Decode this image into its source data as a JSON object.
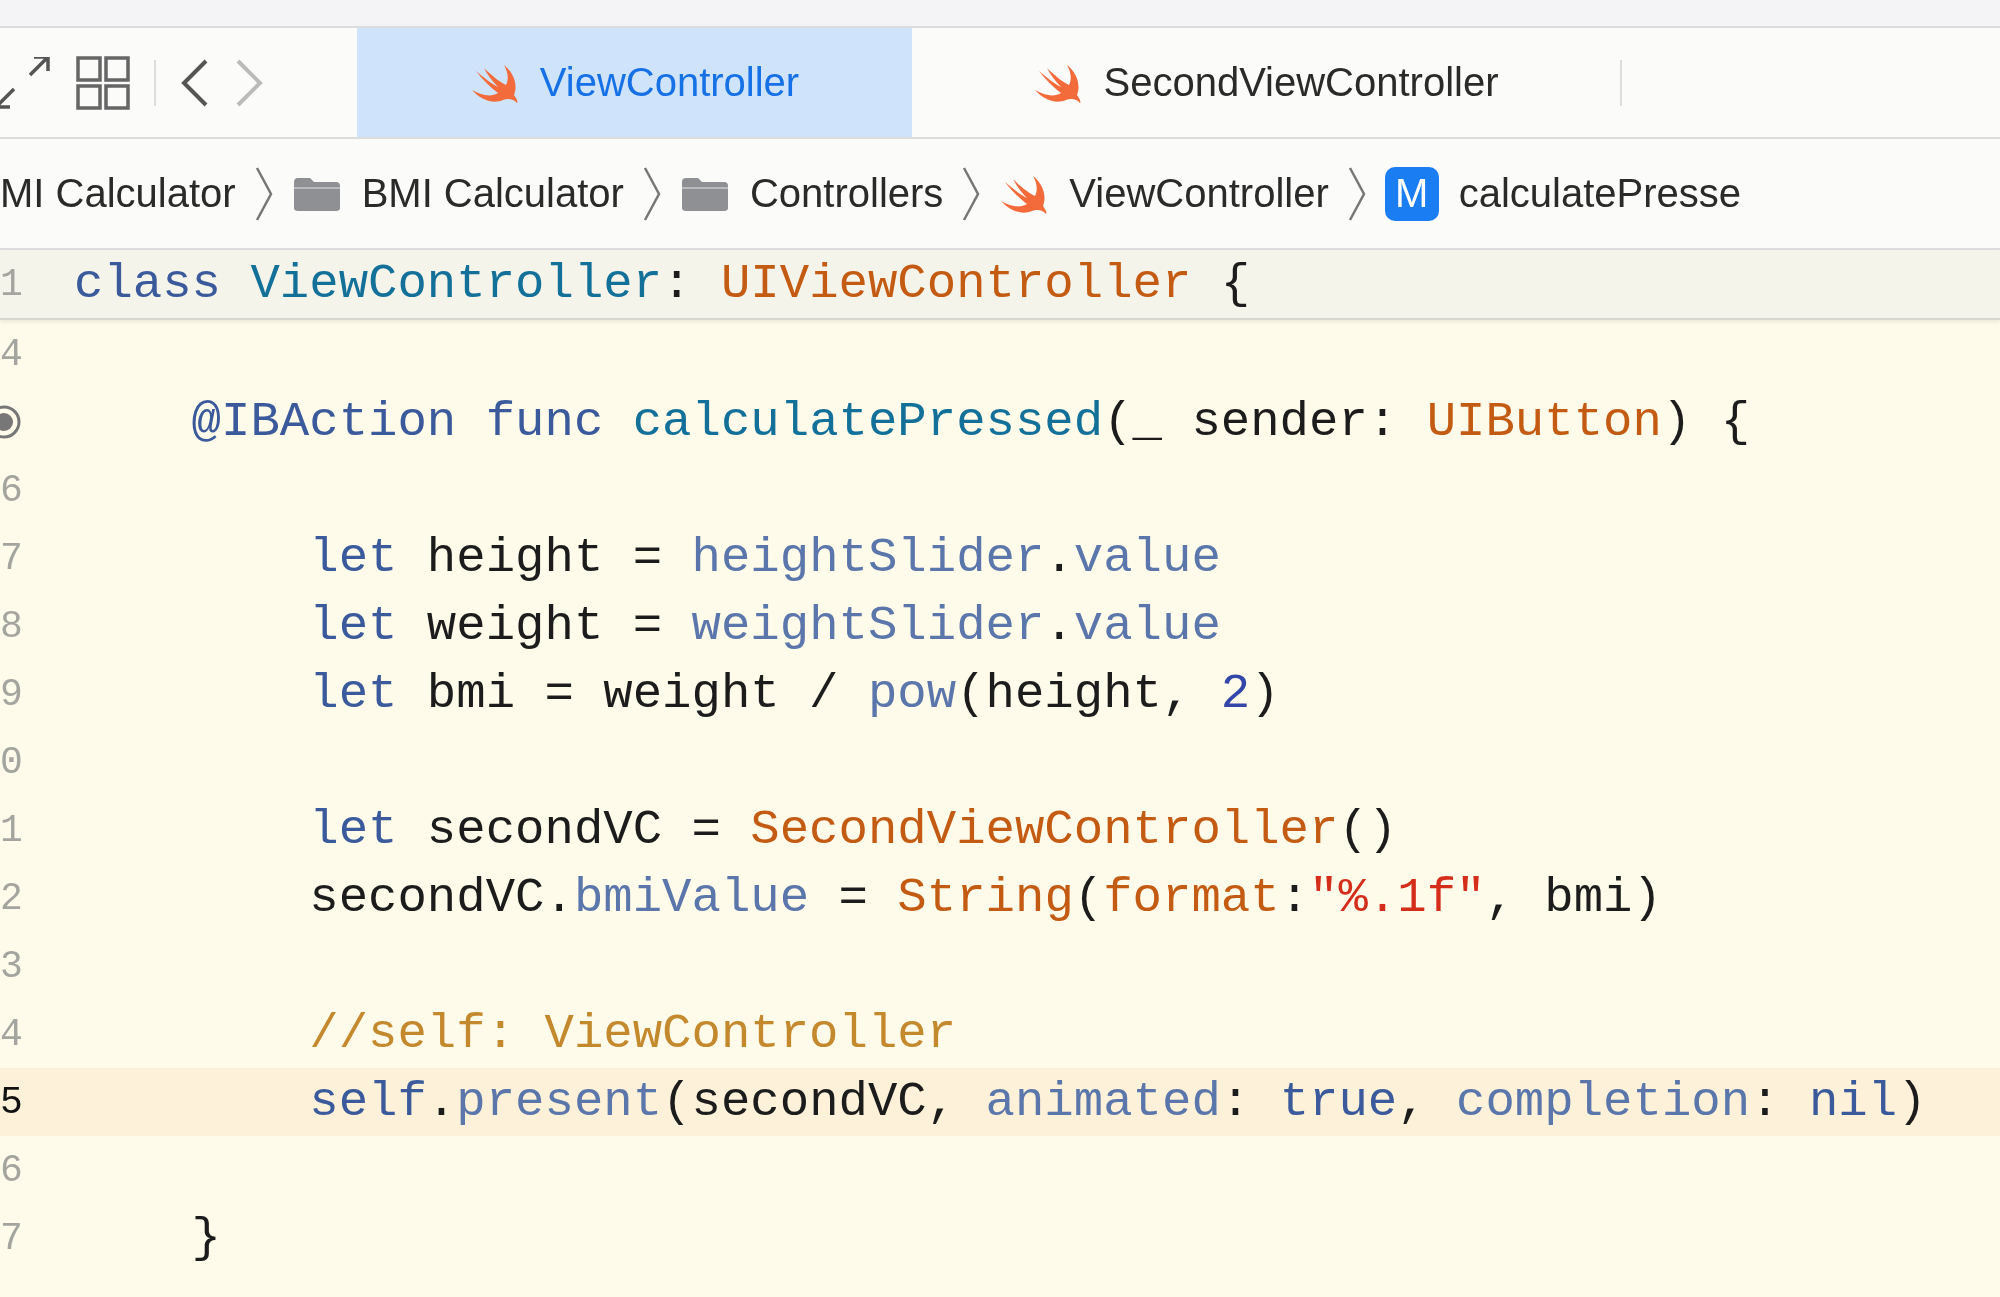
{
  "toolbar": {
    "back_enabled": true,
    "forward_enabled": false
  },
  "tabs": [
    {
      "label": "ViewController",
      "selected": true
    },
    {
      "label": "SecondViewController",
      "selected": false
    }
  ],
  "breadcrumb": [
    {
      "label": "MI Calculator",
      "kind": "project"
    },
    {
      "label": "BMI Calculator",
      "kind": "folder"
    },
    {
      "label": "Controllers",
      "kind": "folder"
    },
    {
      "label": "ViewController",
      "kind": "swift"
    },
    {
      "label": "calculatePresse",
      "kind": "method",
      "badge": "M"
    }
  ],
  "sticky_line": {
    "number": "1",
    "tokens": [
      {
        "text": "class ",
        "kind": "kw"
      },
      {
        "text": "ViewController",
        "kind": "decl"
      },
      {
        "text": ": ",
        "kind": "plain"
      },
      {
        "text": "UIViewController",
        "kind": "type"
      },
      {
        "text": " {",
        "kind": "plain"
      }
    ]
  },
  "lines": [
    {
      "number": "4"
    },
    {
      "connected": true,
      "tokens": [
        {
          "text": "    @IBAction func ",
          "kind": "kw"
        },
        {
          "text": "calculatePressed",
          "kind": "decl"
        },
        {
          "text": "(_ sender: ",
          "kind": "plain"
        },
        {
          "text": "UIButton",
          "kind": "type"
        },
        {
          "text": ") {",
          "kind": "plain"
        }
      ]
    },
    {
      "number": "6"
    },
    {
      "number": "7",
      "tokens": [
        {
          "text": "        let",
          "kind": "kw"
        },
        {
          "text": " height = ",
          "kind": "plain"
        },
        {
          "text": "heightSlider",
          "kind": "ref"
        },
        {
          "text": ".",
          "kind": "plain"
        },
        {
          "text": "value",
          "kind": "ref"
        }
      ]
    },
    {
      "number": "8",
      "tokens": [
        {
          "text": "        let",
          "kind": "kw"
        },
        {
          "text": " weight = ",
          "kind": "plain"
        },
        {
          "text": "weightSlider",
          "kind": "ref"
        },
        {
          "text": ".",
          "kind": "plain"
        },
        {
          "text": "value",
          "kind": "ref"
        }
      ]
    },
    {
      "number": "9",
      "tokens": [
        {
          "text": "        let",
          "kind": "kw"
        },
        {
          "text": " bmi = weight / ",
          "kind": "plain"
        },
        {
          "text": "pow",
          "kind": "ref"
        },
        {
          "text": "(height, ",
          "kind": "plain"
        },
        {
          "text": "2",
          "kind": "num"
        },
        {
          "text": ")",
          "kind": "plain"
        }
      ]
    },
    {
      "number": "0"
    },
    {
      "number": "1",
      "tokens": [
        {
          "text": "        let",
          "kind": "kw"
        },
        {
          "text": " secondVC = ",
          "kind": "plain"
        },
        {
          "text": "SecondViewController",
          "kind": "type"
        },
        {
          "text": "()",
          "kind": "plain"
        }
      ]
    },
    {
      "number": "2",
      "tokens": [
        {
          "text": "        secondVC.",
          "kind": "plain"
        },
        {
          "text": "bmiValue",
          "kind": "ref"
        },
        {
          "text": " = ",
          "kind": "plain"
        },
        {
          "text": "String",
          "kind": "type"
        },
        {
          "text": "(",
          "kind": "plain"
        },
        {
          "text": "format",
          "kind": "type"
        },
        {
          "text": ":",
          "kind": "plain"
        },
        {
          "text": "\"%.1f\"",
          "kind": "str"
        },
        {
          "text": ", bmi)",
          "kind": "plain"
        }
      ]
    },
    {
      "number": "3"
    },
    {
      "number": "4",
      "tokens": [
        {
          "text": "        //self: ViewController",
          "kind": "cmt"
        }
      ]
    },
    {
      "number": "5",
      "current": true,
      "tokens": [
        {
          "text": "        self",
          "kind": "kw"
        },
        {
          "text": ".",
          "kind": "plain"
        },
        {
          "text": "present",
          "kind": "ref"
        },
        {
          "text": "(secondVC, ",
          "kind": "plain"
        },
        {
          "text": "animated",
          "kind": "ref"
        },
        {
          "text": ": ",
          "kind": "plain"
        },
        {
          "text": "true",
          "kind": "kw"
        },
        {
          "text": ", ",
          "kind": "plain"
        },
        {
          "text": "completion",
          "kind": "ref"
        },
        {
          "text": ": ",
          "kind": "plain"
        },
        {
          "text": "nil",
          "kind": "kw"
        },
        {
          "text": ")",
          "kind": "plain"
        }
      ]
    },
    {
      "number": "6"
    },
    {
      "number": "7",
      "tokens": [
        {
          "text": "    }",
          "kind": "plain"
        }
      ]
    }
  ]
}
